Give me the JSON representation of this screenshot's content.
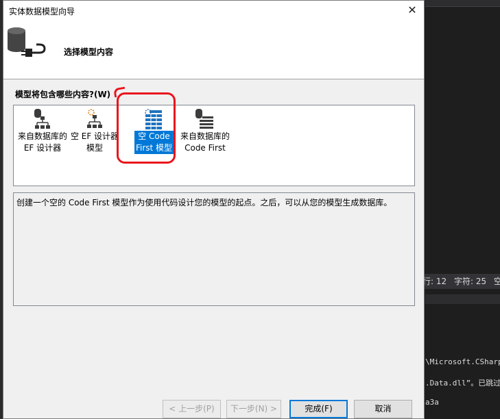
{
  "dialog": {
    "title": "实体数据模型向导",
    "close_glyph": "✕",
    "header_title": "选择模型内容",
    "question": "模型将包含哪些内容?(W)",
    "options": [
      {
        "label": "来自数据库的\nEF 设计器",
        "icon": "database-designer-icon",
        "selected": false
      },
      {
        "label": "空 EF 设计器\n模型",
        "icon": "empty-designer-icon",
        "selected": false
      },
      {
        "label": "空 Code\nFirst 模型",
        "icon": "empty-code-first-icon",
        "selected": true
      },
      {
        "label": "来自数据库的\nCode First",
        "icon": "database-code-first-icon",
        "selected": false
      }
    ],
    "description": "创建一个空的 Code First 模型作为使用代码设计您的模型的起点。之后，可以从您的模型生成数据库。",
    "buttons": {
      "back": "< 上一步(P)",
      "next": "下一步(N) >",
      "finish": "完成(F)",
      "cancel": "取消"
    }
  },
  "ide": {
    "status_line": "行: 12",
    "status_char": "字符: 25",
    "status_extra": "空",
    "output_line_1": "\\Microsoft.CSharp.",
    "output_line_2": ".Data.dll”。已跳过",
    "output_line_3": "a3a"
  },
  "colors": {
    "selection": "#0078d7",
    "annotation": "#e8141c"
  }
}
